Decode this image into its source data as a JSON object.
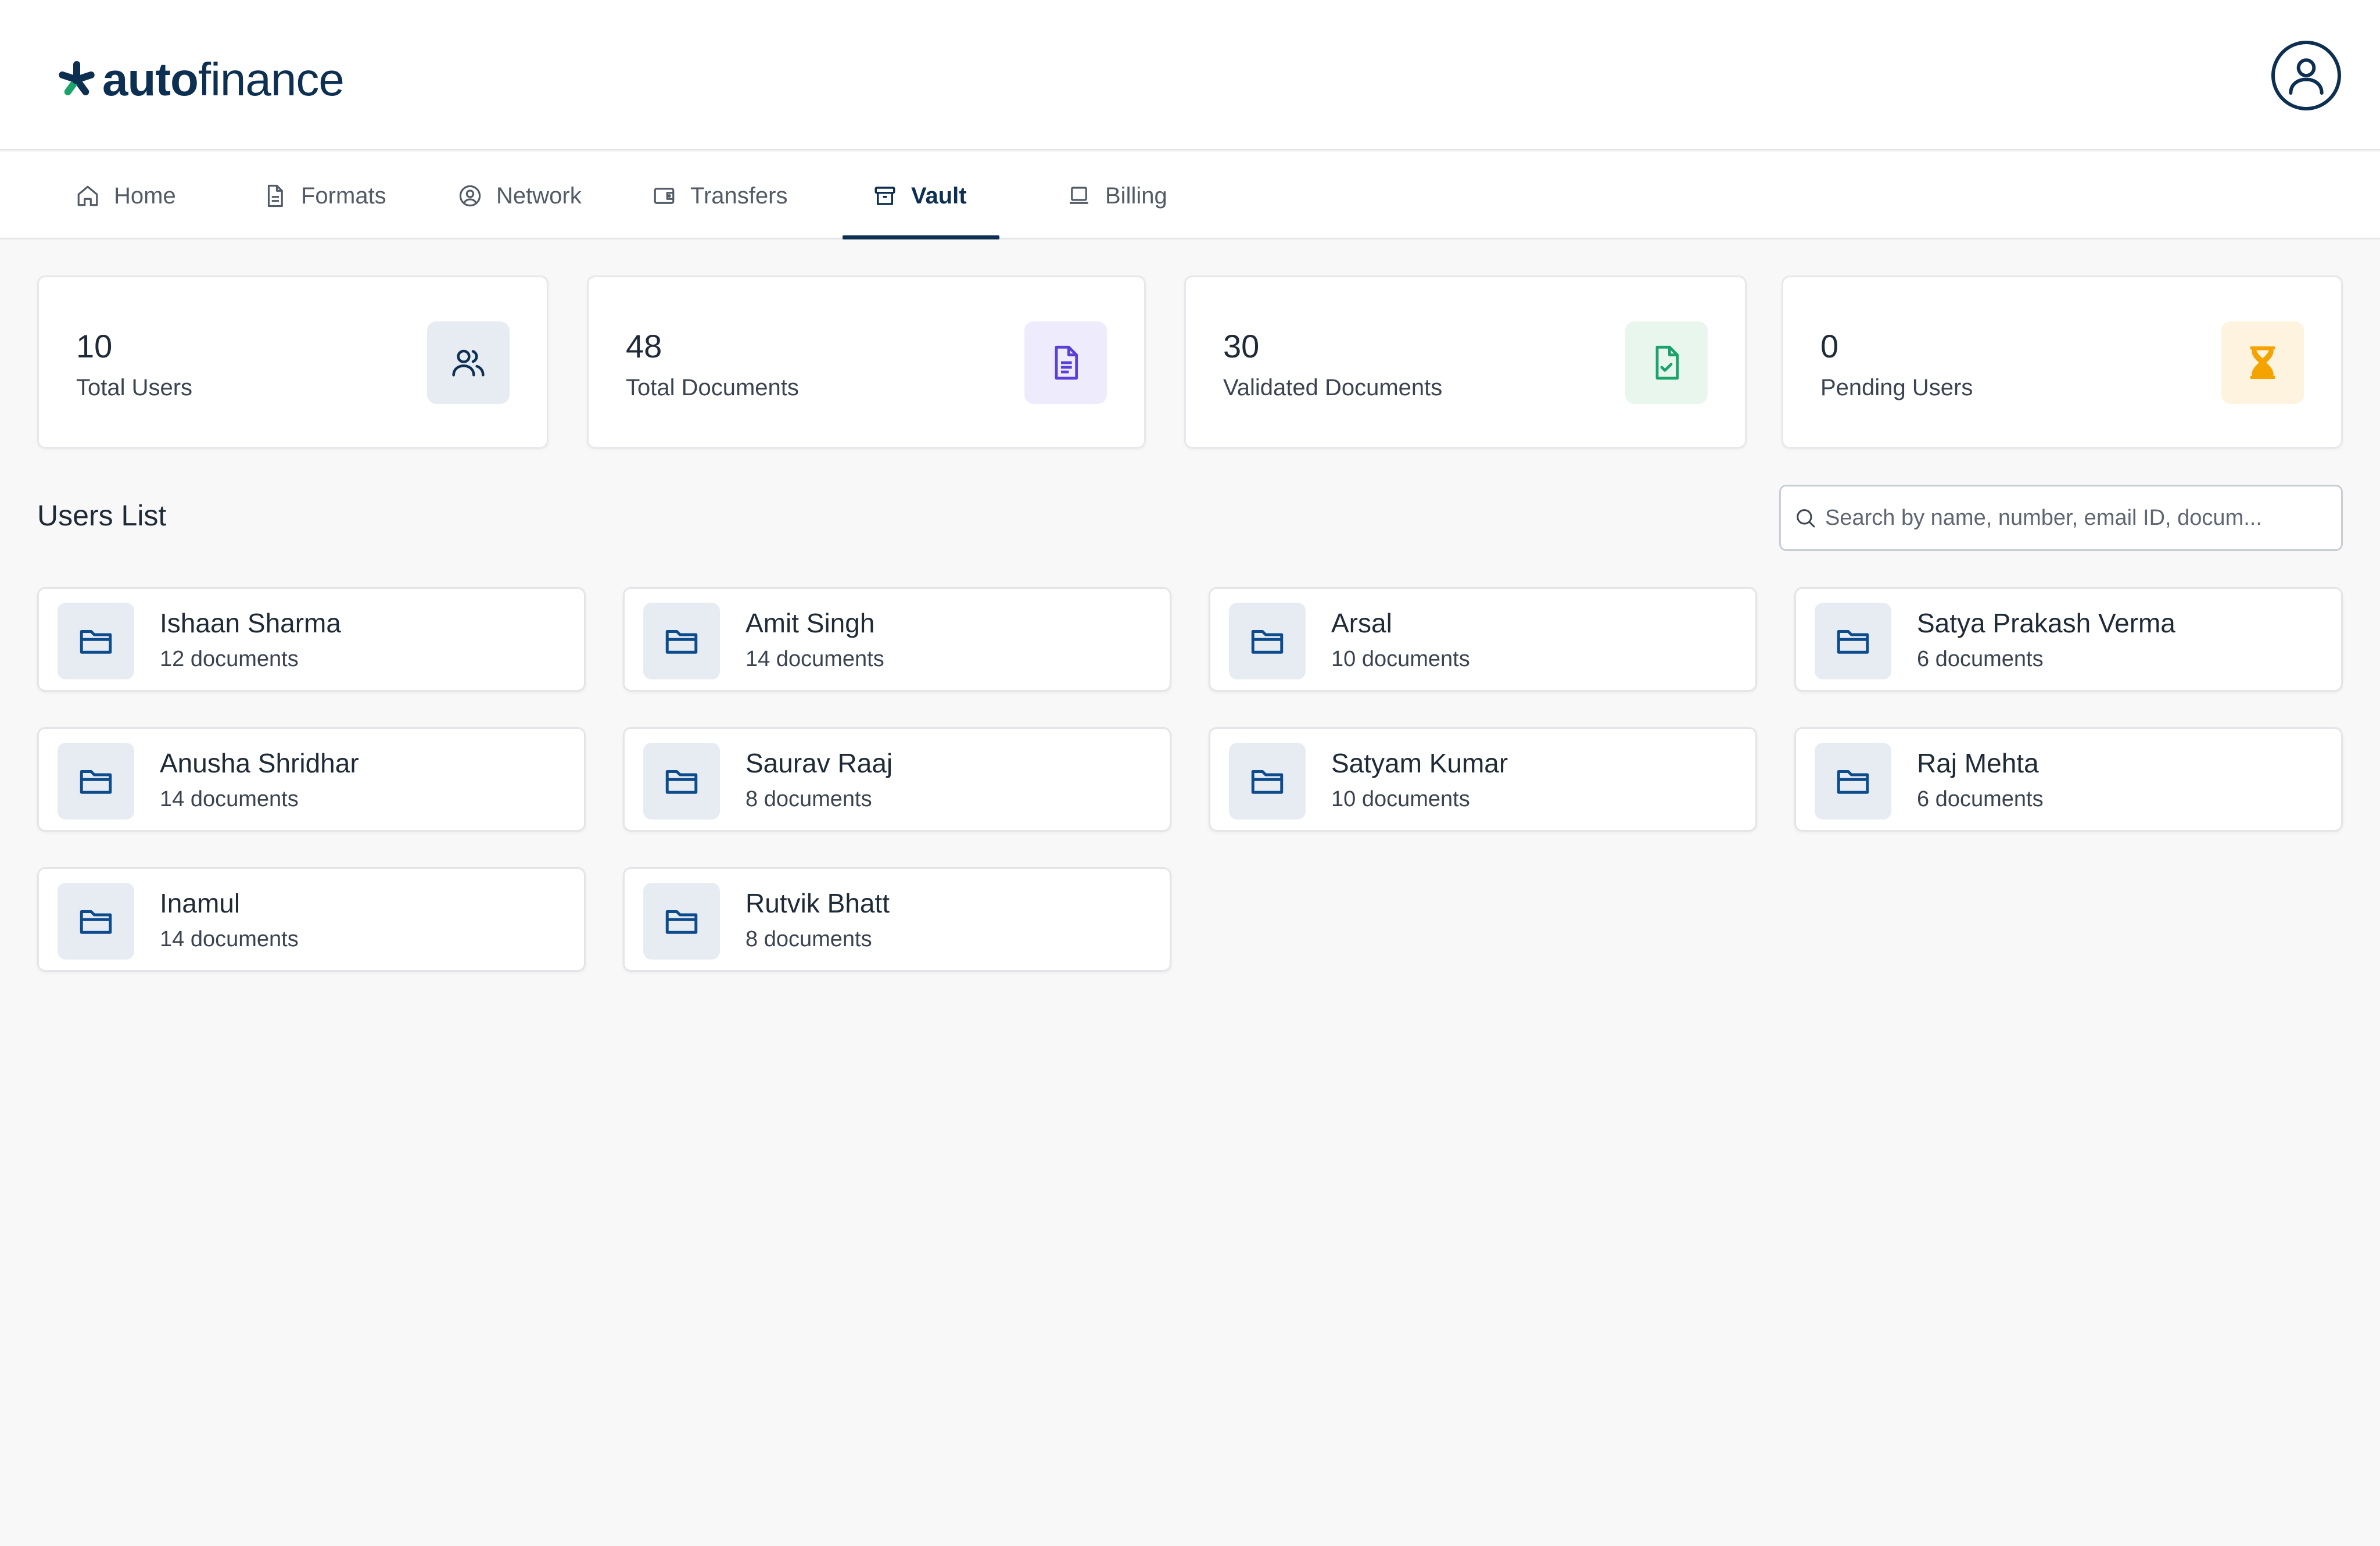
{
  "app": {
    "logo_bold": "auto",
    "logo_light": "finance",
    "brand_color": "#0d2f52",
    "accent_color": "#1aa36b"
  },
  "nav": {
    "tabs": [
      {
        "label": "Home",
        "icon": "home-icon"
      },
      {
        "label": "Formats",
        "icon": "document-icon"
      },
      {
        "label": "Network",
        "icon": "user-circle-icon"
      },
      {
        "label": "Transfers",
        "icon": "wallet-icon"
      },
      {
        "label": "Vault",
        "icon": "archive-icon",
        "active": true
      },
      {
        "label": "Billing",
        "icon": "laptop-icon"
      }
    ]
  },
  "stats": [
    {
      "value": "10",
      "label": "Total Users",
      "icon": "users-icon",
      "icon_bg": "#e7ecf3",
      "icon_color": "#0d2f52"
    },
    {
      "value": "48",
      "label": "Total Documents",
      "icon": "document-text-icon",
      "icon_bg": "#eeebfc",
      "icon_color": "#5b3fd6"
    },
    {
      "value": "30",
      "label": "Validated Documents",
      "icon": "file-check-icon",
      "icon_bg": "#e8f6ee",
      "icon_color": "#1aa36b"
    },
    {
      "value": "0",
      "label": "Pending Users",
      "icon": "hourglass-icon",
      "icon_bg": "#fdf3df",
      "icon_color": "#f5a300"
    }
  ],
  "users_list": {
    "title": "Users List",
    "search_placeholder": "Search by name, number, email ID, docum...",
    "users": [
      {
        "name": "Ishaan Sharma",
        "docs": "12 documents"
      },
      {
        "name": "Amit Singh",
        "docs": "14 documents"
      },
      {
        "name": "Arsal",
        "docs": "10 documents"
      },
      {
        "name": "Satya Prakash Verma",
        "docs": "6 documents"
      },
      {
        "name": "Anusha Shridhar",
        "docs": "14 documents"
      },
      {
        "name": "Saurav Raaj",
        "docs": "8 documents"
      },
      {
        "name": "Satyam Kumar",
        "docs": "10 documents"
      },
      {
        "name": "Raj Mehta",
        "docs": "6 documents"
      },
      {
        "name": "Inamul",
        "docs": "14 documents"
      },
      {
        "name": "Rutvik Bhatt",
        "docs": "8 documents"
      }
    ]
  }
}
